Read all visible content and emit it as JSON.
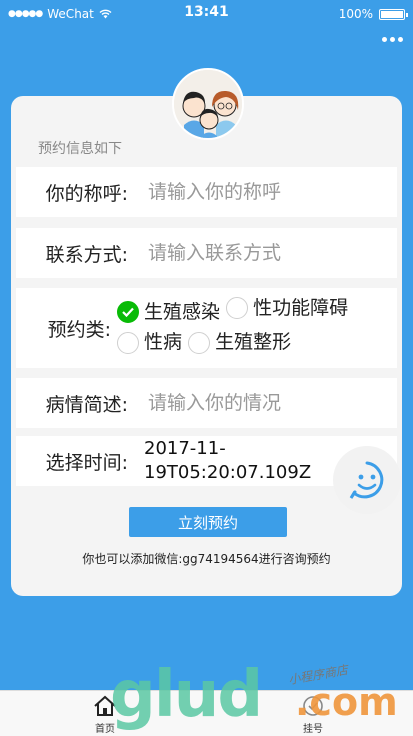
{
  "status_bar": {
    "carrier": "WeChat",
    "time": "13:41",
    "battery_text": "100%",
    "battery_level": 1.0
  },
  "form": {
    "section_title": "预约信息如下",
    "name": {
      "label": "你的称呼:",
      "placeholder": "请输入你的称呼"
    },
    "contact": {
      "label": "联系方式:",
      "placeholder": "请输入联系方式"
    },
    "type": {
      "label": "预约类:",
      "options": [
        {
          "label": "生殖感染",
          "checked": true
        },
        {
          "label": "性功能障碍",
          "checked": false
        },
        {
          "label": "性病",
          "checked": false
        },
        {
          "label": "生殖整形",
          "checked": false
        }
      ]
    },
    "description": {
      "label": "病情简述:",
      "placeholder": "请输入你的情况"
    },
    "time": {
      "label": "选择时间:",
      "value": "2017-11-19T05:20:07.109Z"
    },
    "submit_label": "立刻预约",
    "footnote": "你也可以添加微信:gg74194564进行咨询预约"
  },
  "tabbar": {
    "items": [
      {
        "label": "首页",
        "icon": "home-icon"
      },
      {
        "label": "挂号",
        "icon": "register-icon"
      }
    ]
  },
  "watermark": {
    "brand": "glud",
    "suffix": ".com",
    "script_text": "小程序商店"
  },
  "colors": {
    "primary": "#3c9ee8",
    "check": "#09bb07",
    "card_bg": "#f4f4f4"
  }
}
